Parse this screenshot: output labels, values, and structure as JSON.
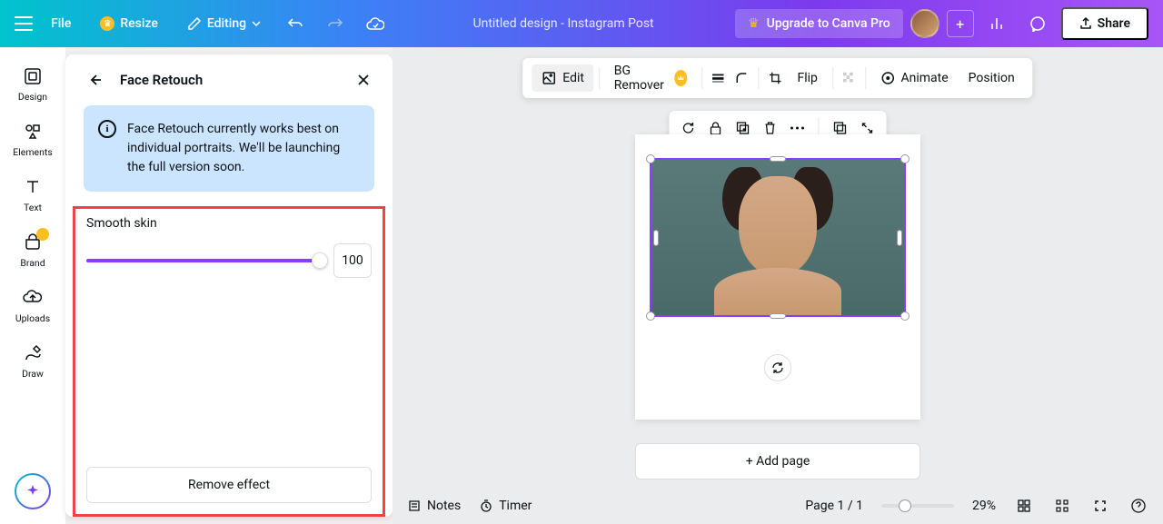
{
  "header": {
    "file": "File",
    "resize": "Resize",
    "editing": "Editing",
    "title": "Untitled design - Instagram Post",
    "upgrade": "Upgrade to Canva Pro",
    "share": "Share"
  },
  "rail": {
    "design": "Design",
    "elements": "Elements",
    "text": "Text",
    "brand": "Brand",
    "uploads": "Uploads",
    "draw": "Draw"
  },
  "panel": {
    "title": "Face Retouch",
    "info": "Face Retouch currently works best on individual portraits. We'll be launching the full version soon.",
    "sliderLabel": "Smooth skin",
    "sliderValue": "100",
    "remove": "Remove effect"
  },
  "context": {
    "edit": "Edit",
    "bgRemover": "BG Remover",
    "flip": "Flip",
    "animate": "Animate",
    "position": "Position"
  },
  "canvas": {
    "addPage": "+ Add page"
  },
  "bottom": {
    "notes": "Notes",
    "timer": "Timer",
    "page": "Page 1 / 1",
    "zoom": "29%"
  }
}
